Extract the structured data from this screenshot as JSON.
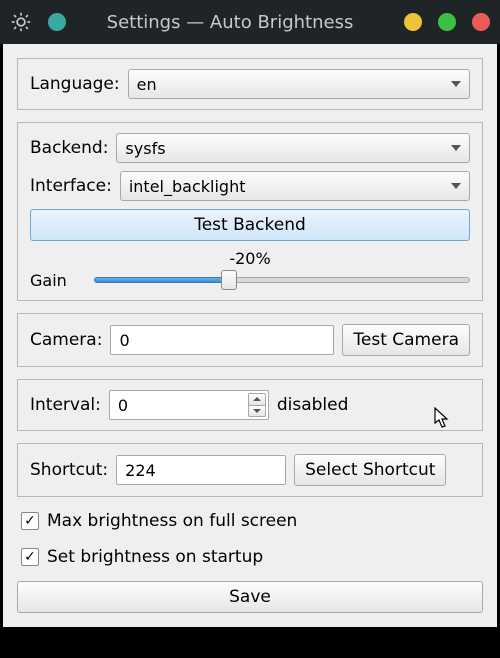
{
  "window": {
    "title": "Settings — Auto Brightness",
    "accent_dot": "#3aa99f",
    "traffic": {
      "min": "#f0c237",
      "max": "#3ac143",
      "close": "#ed5a5a"
    }
  },
  "language": {
    "label": "Language:",
    "value": "en"
  },
  "backend": {
    "label": "Backend:",
    "value": "sysfs",
    "interface_label": "Interface:",
    "interface_value": "intel_backlight",
    "test_label": "Test Backend",
    "gain_label": "Gain",
    "gain_value": "-20%",
    "gain_percent_fill": 36
  },
  "camera": {
    "label": "Camera:",
    "value": "0",
    "test_label": "Test Camera"
  },
  "interval": {
    "label": "Interval:",
    "value": "0",
    "status": "disabled"
  },
  "shortcut": {
    "label": "Shortcut:",
    "value": "224",
    "select_label": "Select Shortcut"
  },
  "checks": {
    "max_brightness_label": "Max brightness on full screen",
    "max_brightness_checked": "✓",
    "startup_label": "Set brightness on startup",
    "startup_checked": "✓"
  },
  "save_label": "Save"
}
